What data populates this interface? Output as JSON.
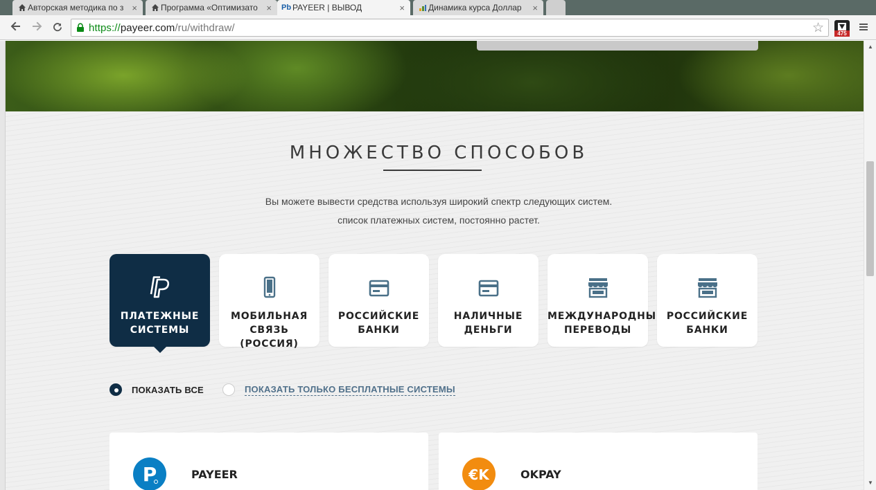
{
  "browser": {
    "tabs": [
      {
        "title": "Авторская методика по з",
        "icon": "house-icon",
        "close": "×"
      },
      {
        "title": "Программа «Оптимизато",
        "icon": "house-icon",
        "close": "×"
      },
      {
        "title": "PAYEER | ВЫВОД",
        "icon": "Pb",
        "close": "×"
      },
      {
        "title": "Динамика курса Доллар",
        "icon": "chart-icon",
        "close": "×"
      }
    ],
    "url_scheme": "https://",
    "url_host": "payeer.com",
    "url_path": "/ru/withdraw/",
    "extension_badge": "475"
  },
  "section": {
    "title": "МНОЖЕСТВО СПОСОБОВ",
    "subtitle_line1": "Вы можете вывести средства используя широкий спектр следующих систем.",
    "subtitle_line2": "список платежных систем, постоянно растет."
  },
  "categories": [
    {
      "label": "ПЛАТЕЖНЫЕ\nСИСТЕМЫ",
      "icon": "paypal-icon",
      "active": true
    },
    {
      "label": "МОБИЛЬНАЯ\nСВЯЗЬ (РОССИЯ)",
      "icon": "phone-icon",
      "active": false
    },
    {
      "label": "РОССИЙСКИЕ\nБАНКИ",
      "icon": "card-icon",
      "active": false
    },
    {
      "label": "НАЛИЧНЫЕ\nДЕНЬГИ",
      "icon": "card-icon",
      "active": false
    },
    {
      "label": "МЕЖДУНАРОДНЫЕ\nПЕРЕВОДЫ",
      "icon": "store-icon",
      "active": false
    },
    {
      "label": "РОССИЙСКИЕ\nБАНКИ",
      "icon": "store-icon",
      "active": false
    }
  ],
  "filters": {
    "show_all": "ПОКАЗАТЬ ВСЕ",
    "show_free": "ПОКАЗАТЬ ТОЛЬКО БЕСПЛАТНЫЕ СИСТЕМЫ"
  },
  "payment_systems": [
    {
      "name": "PAYEER",
      "logo_text": "P",
      "color": "#0a7fc4"
    },
    {
      "name": "OKPAY",
      "logo_text": "€K",
      "color": "#f28c0f"
    }
  ],
  "colors": {
    "accent_dark": "#0f2d45",
    "link": "#50708a"
  }
}
